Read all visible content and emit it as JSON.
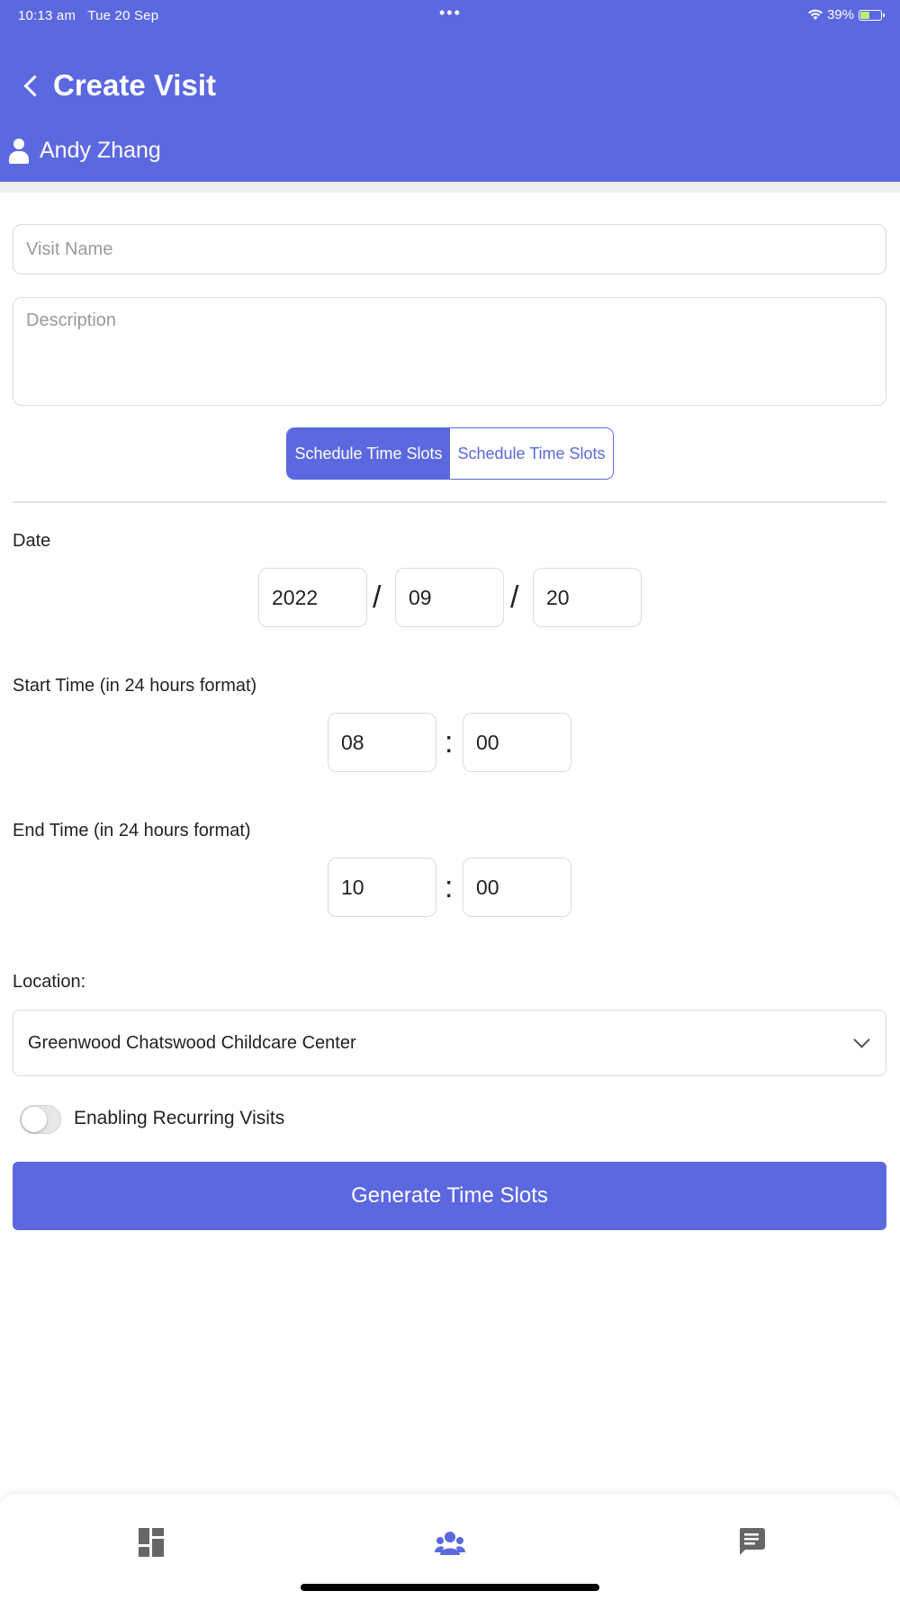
{
  "status": {
    "time": "10:13 am",
    "date": "Tue 20 Sep",
    "battery": "39%"
  },
  "header": {
    "title": "Create Visit",
    "user": "Andy Zhang"
  },
  "form": {
    "visit_name_placeholder": "Visit Name",
    "description_placeholder": "Description",
    "segment": {
      "active": "Schedule Time Slots",
      "inactive": "Schedule Time Slots"
    },
    "date_label": "Date",
    "date": {
      "year": "2022",
      "month": "09",
      "day": "20",
      "separator": "/"
    },
    "start_label": "Start Time (in 24 hours format)",
    "start": {
      "hour": "08",
      "minute": "00"
    },
    "end_label": "End Time (in 24 hours format)",
    "end": {
      "hour": "10",
      "minute": "00"
    },
    "time_separator": ":",
    "location_label": "Location:",
    "location_value": "Greenwood Chatswood Childcare Center",
    "recurring_label": "Enabling Recurring Visits",
    "recurring_enabled": false,
    "generate_button": "Generate Time Slots"
  },
  "tabbar": {
    "items": [
      "dashboard-icon",
      "group-icon",
      "message-icon"
    ],
    "active": "group-icon"
  },
  "colors": {
    "accent": "#5c68e0",
    "inactive_icon": "#666666"
  }
}
